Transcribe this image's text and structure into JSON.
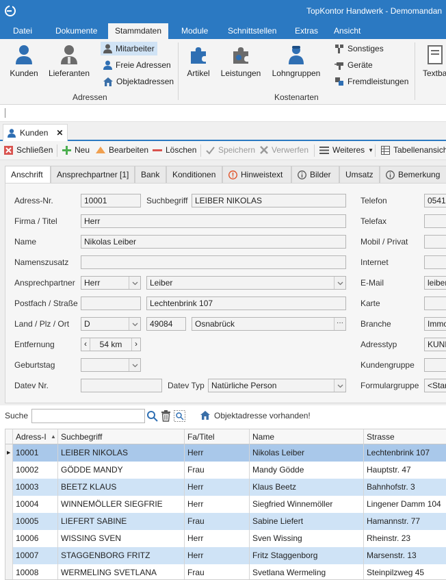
{
  "window": {
    "title": "TopKontor Handwerk - Demomandan"
  },
  "menu": {
    "items": [
      "Datei",
      "Dokumente",
      "Stammdaten",
      "Module",
      "Schnittstellen",
      "Extras",
      "Ansicht"
    ],
    "active": "Stammdaten"
  },
  "ribbon": {
    "kunden": "Kunden",
    "lieferanten": "Lieferanten",
    "mitarbeiter": "Mitarbeiter",
    "freie_adressen": "Freie Adressen",
    "objektadressen": "Objektadressen",
    "group_adressen": "Adressen",
    "artikel": "Artikel",
    "leistungen": "Leistungen",
    "lohngruppen": "Lohngruppen",
    "sonstiges": "Sonstiges",
    "geraete": "Geräte",
    "fremdleistungen": "Fremdleistungen",
    "group_kostenarten": "Kostenarten",
    "textbausteine": "Textba"
  },
  "doctab": {
    "label": "Kunden"
  },
  "toolbar": {
    "schliessen": "Schließen",
    "neu": "Neu",
    "bearbeiten": "Bearbeiten",
    "loeschen": "Löschen",
    "speichern": "Speichern",
    "verwerfen": "Verwerfen",
    "weiteres": "Weiteres",
    "tabellenansicht": "Tabellenansich"
  },
  "subtabs": [
    "Anschrift",
    "Ansprechpartner [1]",
    "Bank",
    "Konditionen",
    "Hinweistext",
    "Bilder",
    "Umsatz",
    "Bemerkung"
  ],
  "form": {
    "adress_nr_label": "Adress-Nr.",
    "adress_nr": "10001",
    "suchbegriff_label": "Suchbegriff",
    "suchbegriff": "LEIBER NIKOLAS",
    "firma_label": "Firma / Titel",
    "firma": "Herr",
    "name_label": "Name",
    "name": "Nikolas Leiber",
    "namenszusatz_label": "Namenszusatz",
    "namenszusatz": "",
    "ansprechpartner_label": "Ansprechpartner",
    "anrede": "Herr",
    "ansprechpartner": "Leiber",
    "strasse_label": "Postfach / Straße",
    "postfach": "",
    "strasse": "Lechtenbrink 107",
    "ort_label": "Land / Plz / Ort",
    "land": "D",
    "plz": "49084",
    "ort": "Osnabrück",
    "ort_btn": "···",
    "entfernung_label": "Entfernung",
    "entfernung": "54 km",
    "entf_prev": "‹",
    "entf_next": "›",
    "geburtstag_label": "Geburtstag",
    "geburtstag": "",
    "datev_nr_label": "Datev Nr.",
    "datev_nr": "",
    "datev_typ_label": "Datev Typ",
    "datev_typ": "Natürliche Person",
    "telefon_label": "Telefon",
    "telefon": "0541-",
    "telefax_label": "Telefax",
    "telefax": "",
    "mobil_label": "Mobil / Privat",
    "mobil": "",
    "internet_label": "Internet",
    "internet": "",
    "email_label": "E-Mail",
    "email": "leiber",
    "karte_label": "Karte",
    "karte": "",
    "branche_label": "Branche",
    "branche": "Immo",
    "adresstyp_label": "Adresstyp",
    "adresstyp": "KUND",
    "kundengruppe_label": "Kundengruppe",
    "kundengruppe": "",
    "formulargruppe_label": "Formulargruppe",
    "formulargruppe": "<Star"
  },
  "search": {
    "label": "Suche",
    "value": "",
    "objekt_hint": "Objektadresse vorhanden!"
  },
  "grid": {
    "columns": [
      "Adress-I",
      "Suchbegriff",
      "Fa/Titel",
      "Name",
      "Strasse"
    ],
    "rows": [
      [
        "10001",
        "LEIBER NIKOLAS",
        "Herr",
        "Nikolas Leiber",
        "Lechtenbrink 107"
      ],
      [
        "10002",
        "GÖDDE MANDY",
        "Frau",
        "Mandy Gödde",
        "Hauptstr. 47"
      ],
      [
        "10003",
        "BEETZ KLAUS",
        "Herr",
        "Klaus Beetz",
        "Bahnhofstr. 3"
      ],
      [
        "10004",
        "WINNEMÖLLER SIEGFRIE",
        "Herr",
        "Siegfried Winnemöller",
        "Lingener Damm 104"
      ],
      [
        "10005",
        "LIEFERT SABINE",
        "Frau",
        "Sabine Liefert",
        "Hamannstr. 77"
      ],
      [
        "10006",
        "WISSING SVEN",
        "Herr",
        "Sven Wissing",
        "Rheinstr. 23"
      ],
      [
        "10007",
        "STAGGENBORG FRITZ",
        "Herr",
        "Fritz Staggenborg",
        "Marsenstr. 13"
      ],
      [
        "10008",
        "WERMELING SVETLANA",
        "Frau",
        "Svetlana Wermeling",
        "Steinpilzweg 45"
      ]
    ]
  },
  "colors": {
    "accent": "#2b79c2",
    "row_alt": "#cfe3f6",
    "row_selected": "#a9c8ea"
  }
}
